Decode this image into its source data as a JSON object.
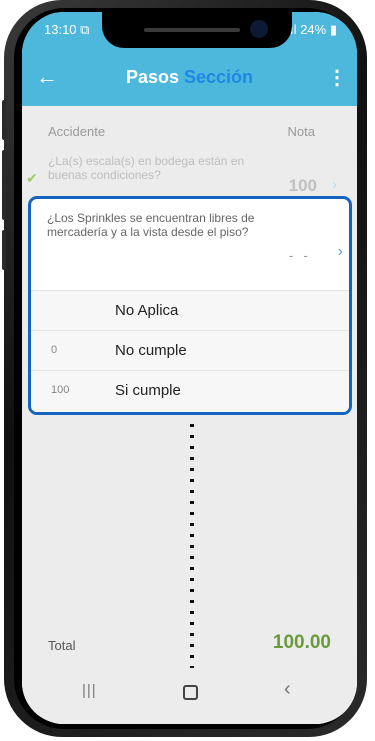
{
  "status_bar": {
    "time": "13:10",
    "time_icon": "screenshot-icon",
    "signal": ".ıl",
    "battery": "24%"
  },
  "app_bar": {
    "back_icon": "back-arrow-icon",
    "title_main": "Pasos",
    "title_highlight": "Sección",
    "menu_icon": "more-vert-icon"
  },
  "table_header": {
    "left": "Accidente",
    "right": "Nota"
  },
  "items": [
    {
      "question": "¿La(s) escala(s) en bodega están en buenas condiciones?",
      "score": "100",
      "completed": true
    }
  ],
  "active_item": {
    "question": "¿Los Sprinkles se encuentran libres de mercadería y a la vista desde el piso?",
    "score": "- -",
    "options": [
      {
        "value": "",
        "label": "No Aplica"
      },
      {
        "value": "0",
        "label": "No cumple"
      },
      {
        "value": "100",
        "label": "Si cumple"
      }
    ]
  },
  "total": {
    "label": "Total",
    "value": "100.00"
  },
  "colors": {
    "accent": "#4db8dc",
    "highlight": "#1e88e5",
    "panel_border": "#1565c0",
    "total_green": "#6a9b3a"
  }
}
